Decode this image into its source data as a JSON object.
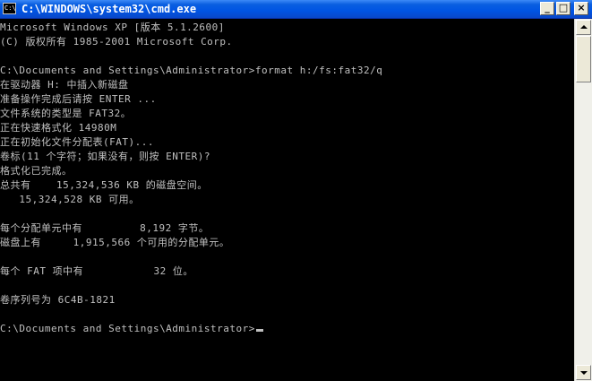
{
  "window": {
    "title": "C:\\WINDOWS\\system32\\cmd.exe",
    "icon": "cmd-console-icon",
    "icon_text": "C:\\",
    "buttons": {
      "minimize": "_",
      "maximize": "□",
      "close": "×"
    }
  },
  "console": {
    "text_color": "#c0c0c0",
    "background": "#000000",
    "lines": [
      "Microsoft Windows XP [版本 5.1.2600]",
      "(C) 版权所有 1985-2001 Microsoft Corp.",
      "",
      "C:\\Documents and Settings\\Administrator>format h:/fs:fat32/q",
      "在驱动器 H: 中插入新磁盘",
      "准备操作完成后请按 ENTER ...",
      "文件系统的类型是 FAT32。",
      "正在快速格式化 14980M",
      "正在初始化文件分配表(FAT)...",
      "卷标(11 个字符；如果没有，则按 ENTER)?",
      "格式化已完成。",
      "总共有    15,324,536 KB 的磁盘空间。",
      "   15,324,528 KB 可用。",
      "",
      "每个分配单元中有         8,192 字节。",
      "磁盘上有     1,915,566 个可用的分配单元。",
      "",
      "每个 FAT 项中有           32 位。",
      "",
      "卷序列号为 6C4B-1821",
      "",
      "C:\\Documents and Settings\\Administrator>"
    ]
  },
  "scrollbar": {
    "position": "top"
  }
}
